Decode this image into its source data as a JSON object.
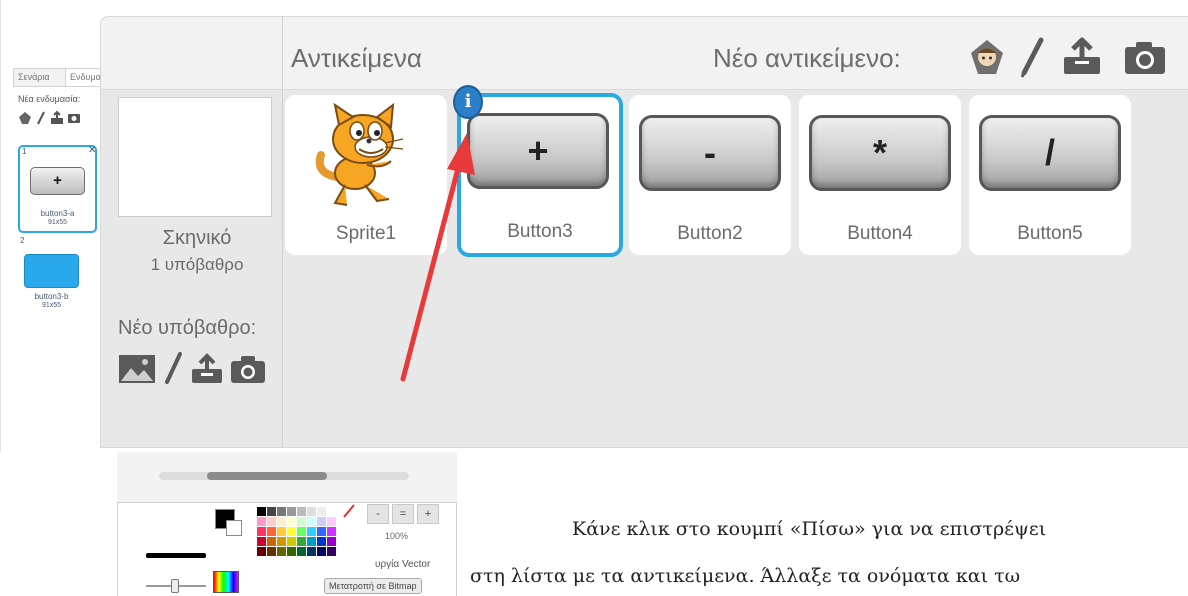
{
  "left_panel": {
    "tabs": [
      "Σενάρια",
      "Ενδυμασίες"
    ],
    "new_costume_label": "Νέα ενδυμασία:",
    "costumes": [
      {
        "number": "1",
        "symbol": "+",
        "name": "button3-a",
        "size": "91x55"
      },
      {
        "number": "2",
        "name": "button3-b",
        "size": "91x55"
      }
    ]
  },
  "sprites_pane": {
    "title": "Αντικείμενα",
    "new_sprite_label": "Νέο αντικείμενο:",
    "header_icons": [
      "choose-sprite-icon",
      "paint-icon",
      "upload-icon",
      "camera-icon"
    ],
    "stage": {
      "name": "Σκηνικό",
      "backdrop_count": "1 υπόβαθρο",
      "new_backdrop_label": "Νέο υπόβαθρο:",
      "backdrop_icons": [
        "library-icon",
        "paint-icon",
        "upload-icon",
        "camera-icon"
      ]
    },
    "sprites": [
      {
        "name": "Sprite1",
        "kind": "cat"
      },
      {
        "name": "Button3",
        "kind": "button",
        "symbol": "+",
        "selected": true,
        "info_badge": "i"
      },
      {
        "name": "Button2",
        "kind": "button",
        "symbol": "-"
      },
      {
        "name": "Button4",
        "kind": "button",
        "symbol": "*"
      },
      {
        "name": "Button5",
        "kind": "button",
        "symbol": "/"
      }
    ],
    "selection_color": "#29a9e0",
    "annotation_arrow_color": "#e83a3a"
  },
  "paint_editor": {
    "zoom_percent": "100%",
    "zoom_buttons": [
      "-",
      "=",
      "+"
    ],
    "mode_label": "υργία Vector",
    "convert_button": "Μετατροπή σε Bitmap"
  },
  "paragraph": {
    "line1": "Κάνε κλικ στο κουμπί «Πίσω» για να επιστρέψει",
    "line2": "στη λίστα με τα αντικείμενα. Άλλαξε τα ονόματα και τω"
  }
}
